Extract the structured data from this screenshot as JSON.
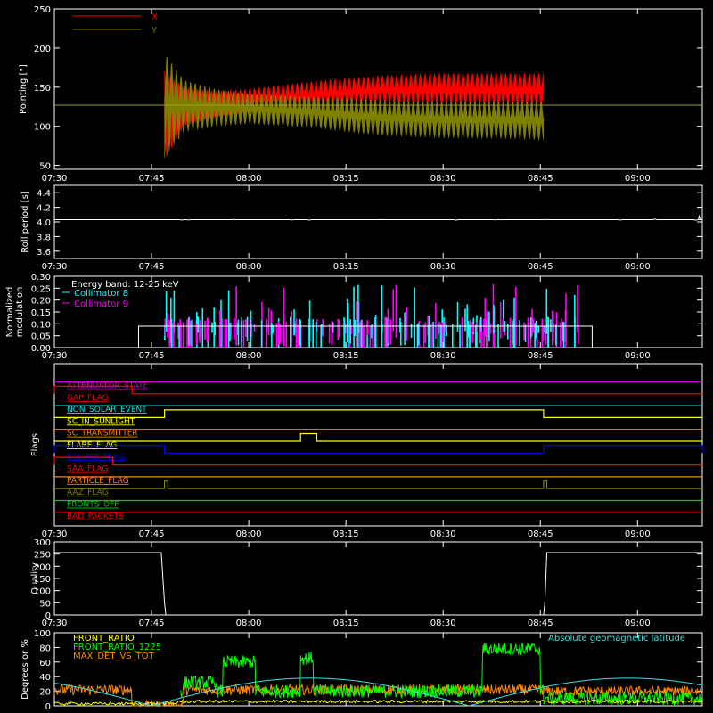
{
  "chart_data": [
    {
      "type": "line",
      "panel": "pointing",
      "ylabel": "Pointing [\"]",
      "ylim": [
        45,
        250
      ],
      "yticks": [
        50,
        100,
        150,
        200,
        250
      ],
      "xticks": [
        "07:30",
        "07:45",
        "08:00",
        "08:15",
        "08:30",
        "08:45",
        "09:00"
      ],
      "xlim_minutes": [
        0,
        100
      ],
      "reference_y": 127,
      "series": [
        {
          "name": "X",
          "color": "#ff0000",
          "envelope": {
            "t": [
              17,
              20,
              25,
              30,
              40,
              50,
              60,
              70,
              75.5
            ],
            "upper": [
              170,
              150,
              145,
              148,
              158,
              165,
              168,
              168,
              168
            ],
            "lower": [
              55,
              100,
              112,
              118,
              123,
              128,
              126,
              125,
              124
            ]
          }
        },
        {
          "name": "Y",
          "color": "#808000",
          "envelope": {
            "t": [
              17,
              20,
              25,
              30,
              40,
              50,
              60,
              70,
              75.5
            ],
            "upper": [
              195,
              160,
              148,
              142,
              138,
              134,
              132,
              132,
              132
            ],
            "lower": [
              60,
              92,
              100,
              103,
              98,
              88,
              85,
              84,
              82
            ]
          }
        }
      ]
    },
    {
      "type": "line",
      "panel": "roll",
      "ylabel": "Roll period [s]",
      "ylim": [
        3.5,
        4.5
      ],
      "yticks": [
        "3.6",
        "3.8",
        "4.0",
        "4.2",
        "4.4"
      ],
      "xticks": [
        "07:30",
        "07:45",
        "08:00",
        "08:15",
        "08:30",
        "08:45",
        "09:00"
      ],
      "series": [
        {
          "name": "",
          "color": "#ffffff",
          "x": [
            0,
            100
          ],
          "y": [
            4.03,
            4.03
          ]
        }
      ]
    },
    {
      "type": "bar",
      "panel": "modulation",
      "ylabel": "Normalized modulation",
      "ylim": [
        0,
        0.3
      ],
      "yticks": [
        "0.00",
        "0.05",
        "0.10",
        "0.15",
        "0.20",
        "0.25",
        "0.30"
      ],
      "xticks": [
        "07:30",
        "07:45",
        "08:00",
        "08:15",
        "08:30",
        "08:45",
        "09:00"
      ],
      "annotation": "Energy band: 12-25 keV",
      "active_range_minutes": [
        13,
        83
      ],
      "baseline_value": 0.09,
      "series": [
        {
          "name": "Collimator 8",
          "color": "#00ffff"
        },
        {
          "name": "Collimator 9",
          "color": "#ff00ff"
        }
      ]
    },
    {
      "type": "line",
      "panel": "flags",
      "ylabel": "Flags",
      "xticks": [
        "07:30",
        "07:45",
        "08:00",
        "08:15",
        "08:30",
        "08:45",
        "09:00"
      ],
      "flags": [
        {
          "name": "ATTENUATOR_STATE",
          "color": "#cc00cc",
          "on": []
        },
        {
          "name": "GAP_FLAG",
          "color": "#ff0000",
          "on": [
            [
              0,
              12
            ]
          ]
        },
        {
          "name": "NON_SOLAR_EVENT",
          "color": "#00e5e5",
          "on": []
        },
        {
          "name": "SC_IN_SUNLIGHT",
          "color": "#ffff00",
          "on": [
            [
              17,
              75.5
            ]
          ]
        },
        {
          "name": "SC_TRANSMITTER",
          "color": "#ff7f00",
          "on": []
        },
        {
          "name": "FLARE_FLAG",
          "color": "#ffff00",
          "on": [
            [
              38,
              40.5
            ]
          ]
        },
        {
          "name": "ECLIPSE_FLAG",
          "color": "#0000ff",
          "on": [
            [
              0,
              17
            ],
            [
              75.5,
              100
            ]
          ]
        },
        {
          "name": "SAA_FLAG",
          "color": "#ff0000",
          "on": [
            [
              0,
              9
            ]
          ]
        },
        {
          "name": "PARTICLE_FLAG",
          "color": "#ff7f00",
          "on": []
        },
        {
          "name": "AAZ_FLAG",
          "color": "#808000",
          "on": [
            [
              17,
              17.5
            ],
            [
              75.5,
              76
            ]
          ]
        },
        {
          "name": "FRONTS_OFF",
          "color": "#00cc00",
          "on": []
        },
        {
          "name": "BAD_PACKETS",
          "color": "#ff0000",
          "on": []
        }
      ]
    },
    {
      "type": "line",
      "panel": "quality",
      "ylabel": "Quality",
      "ylim": [
        0,
        300
      ],
      "yticks": [
        "0",
        "50",
        "100",
        "150",
        "200",
        "250",
        "300"
      ],
      "xticks": [
        "07:30",
        "07:45",
        "08:00",
        "08:15",
        "08:30",
        "08:45",
        "09:00"
      ],
      "series": [
        {
          "name": "",
          "color": "#ffffff",
          "x": [
            0,
            16.5,
            17,
            17.2,
            75.5,
            75.7,
            76,
            100
          ],
          "y": [
            256,
            256,
            50,
            0,
            0,
            50,
            256,
            256
          ]
        }
      ]
    },
    {
      "type": "line",
      "panel": "ratios",
      "ylabel": "Degrees or %",
      "ylim": [
        0,
        100
      ],
      "yticks": [
        "0",
        "20",
        "40",
        "60",
        "80",
        "100"
      ],
      "series": [
        {
          "name": "FRONT_RATIO",
          "color": "#ffff00"
        },
        {
          "name": "FRONT_RATIO_1225",
          "color": "#00ff00"
        },
        {
          "name": "MAX_DET_VS_TOT",
          "color": "#ff8800"
        },
        {
          "name": "Absolute geomagnetic latitude",
          "color": "#40e0e0"
        }
      ]
    }
  ]
}
